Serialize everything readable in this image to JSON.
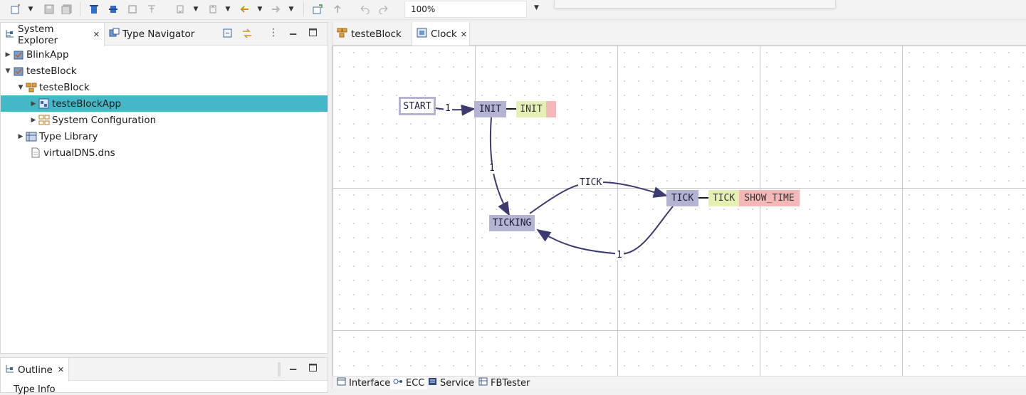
{
  "toolbar": {
    "zoom": "100%"
  },
  "left_panel": {
    "tabs": [
      {
        "label": "System Explorer",
        "active": true
      },
      {
        "label": "Type Navigator",
        "active": false
      }
    ],
    "tree": [
      {
        "label": "BlinkApp",
        "icon": "system-icon",
        "expanded": false,
        "selected": false
      },
      {
        "label": "testeBlock",
        "icon": "system-icon",
        "expanded": true,
        "selected": false
      },
      {
        "label": "testeBlock",
        "icon": "folder-icon",
        "expanded": true,
        "selected": false
      },
      {
        "label": "testeBlockApp",
        "icon": "application-icon",
        "expanded": false,
        "selected": true
      },
      {
        "label": "System Configuration",
        "icon": "system-configuration-icon",
        "expanded": false,
        "selected": false
      },
      {
        "label": "Type Library",
        "icon": "type-library-icon",
        "expanded": false,
        "selected": false
      },
      {
        "label": "virtualDNS.dns",
        "icon": "file-icon",
        "expanded": false,
        "selected": false
      }
    ]
  },
  "outline_panel": {
    "tab": "Outline",
    "first_item": "Type Info"
  },
  "editor": {
    "tabs": [
      {
        "label": "testeBlock",
        "active": false
      },
      {
        "label": "Clock",
        "active": true
      }
    ],
    "ecc": {
      "states": {
        "start": "START",
        "init": "INIT",
        "ticking": "TICKING",
        "tick": "TICK"
      },
      "algorithms": {
        "init": "INIT",
        "tick": "TICK"
      },
      "output_events": {
        "tick": "SHOW_TIME"
      },
      "transitions": {
        "start_init": "1",
        "init_ticking": "1",
        "ticking_tick": "TICK",
        "tick_ticking": "1"
      }
    },
    "bottom_tabs": [
      {
        "label": "Interface",
        "active": false
      },
      {
        "label": "ECC",
        "active": true
      },
      {
        "label": "Service",
        "active": false
      },
      {
        "label": "FBTester",
        "active": false
      }
    ]
  },
  "colors": {
    "selection": "#45b8c7",
    "state": "#b4b4d2",
    "algorithm": "#e6f0b2",
    "output_event": "#f4b8b8",
    "transition": "#3c3a6e"
  }
}
